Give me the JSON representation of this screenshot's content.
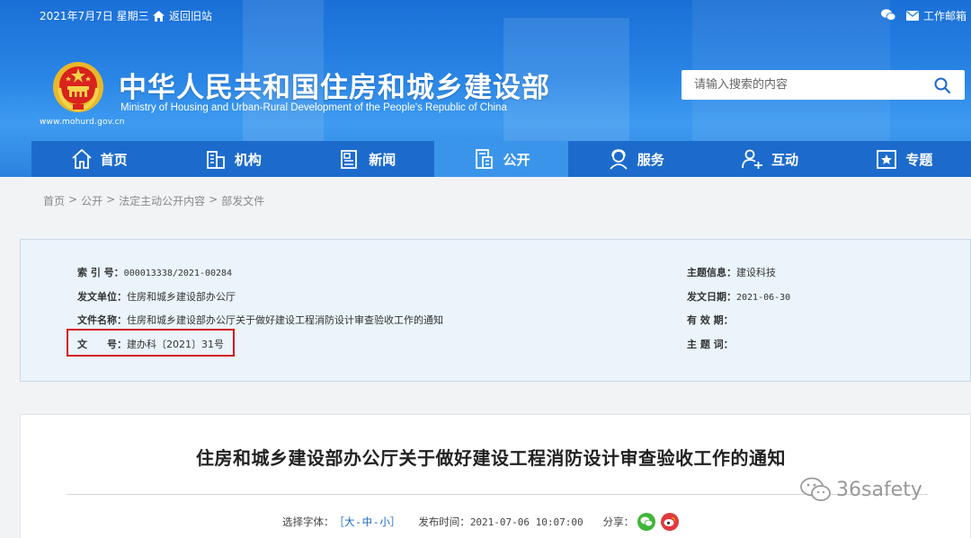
{
  "topbar": {
    "date": "2021年7月7日  星期三",
    "old_site": "返回旧站",
    "mail": "工作邮箱"
  },
  "header": {
    "title_cn": "中华人民共和国住房和城乡建设部",
    "title_en": "Ministry of Housing and Urban-Rural Development of the People's Republic of China",
    "url": "www.mohurd.gov.cn",
    "search_placeholder": "请输入搜索的内容"
  },
  "nav": [
    {
      "label": "首页"
    },
    {
      "label": "机构"
    },
    {
      "label": "新闻"
    },
    {
      "label": "公开"
    },
    {
      "label": "服务"
    },
    {
      "label": "互动"
    },
    {
      "label": "专题"
    }
  ],
  "breadcrumb": [
    "首页",
    "公开",
    "法定主动公开内容",
    "部发文件"
  ],
  "meta": {
    "index_label": "索 引 号：",
    "index_value": "000013338/2021-00284",
    "unit_label": "发文单位：",
    "unit_value": "住房和城乡建设部办公厅",
    "name_label": "文件名称：",
    "name_value": "住房和城乡建设部办公厅关于做好建设工程消防设计审查验收工作的通知",
    "doc_label": "文　　号：",
    "doc_value": "建办科〔2021〕31号",
    "topic_label": "主题信息：",
    "topic_value": "建设科技",
    "date_label": "发文日期：",
    "date_value": "2021-06-30",
    "valid_label": "有 效 期：",
    "valid_value": "",
    "keywords_label": "主 题 词：",
    "keywords_value": ""
  },
  "article": {
    "title": "住房和城乡建设部办公厅关于做好建设工程消防设计审查验收工作的通知",
    "font_label": "选择字体：",
    "font_open": "［",
    "font_large": "大",
    "font_mid": "中",
    "font_small": "小",
    "font_close": "］",
    "sep": "-",
    "publish_label": "发布时间：",
    "publish_value": "2021-07-06 10:07:00",
    "share_label": "分享："
  },
  "watermark": "36safety",
  "colors": {
    "header_blue": "#2a86e6",
    "nav_blue": "#1c6bcc",
    "nav_active": "#3a95ea",
    "highlight_red": "#d2161b",
    "meta_bg": "#ebf4fb"
  }
}
